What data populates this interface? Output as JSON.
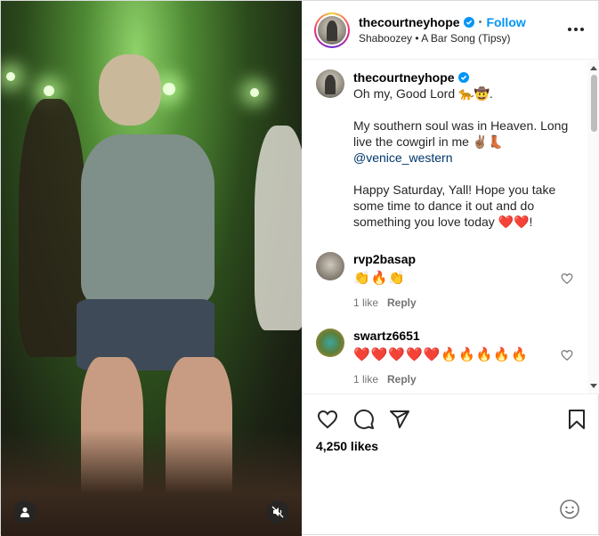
{
  "post": {
    "username": "thecourtneyhope",
    "follow_label": "Follow",
    "audio": "Shaboozey • A Bar Song (Tipsy)",
    "more_menu": "more-options"
  },
  "caption": {
    "username": "thecourtneyhope",
    "line1": "Oh my, Good Lord 🐆🤠.",
    "line2": "My southern soul was in Heaven. Long live the cowgirl in me ✌🏽👢",
    "mention": "@venice_western",
    "line3": "Happy Saturday, Yall! Hope you take some time to dance it out and do something you love today ❤️❤️!"
  },
  "comments": [
    {
      "username": "rvp2basap",
      "text": "👏🔥👏",
      "likes": "1 like",
      "reply": "Reply"
    },
    {
      "username": "swartz6651",
      "text": "❤️❤️❤️❤️❤️🔥🔥🔥🔥🔥",
      "likes": "1 like",
      "reply": "Reply"
    }
  ],
  "footer": {
    "likes": "4,250 likes"
  },
  "colors": {
    "accent": "#0095f6",
    "verified": "#0095f6",
    "mention": "#00376b"
  },
  "icons": [
    "heart-icon",
    "comment-icon",
    "share-icon",
    "bookmark-icon",
    "emoji-icon",
    "user-tag-icon",
    "mute-icon",
    "verified-icon"
  ]
}
